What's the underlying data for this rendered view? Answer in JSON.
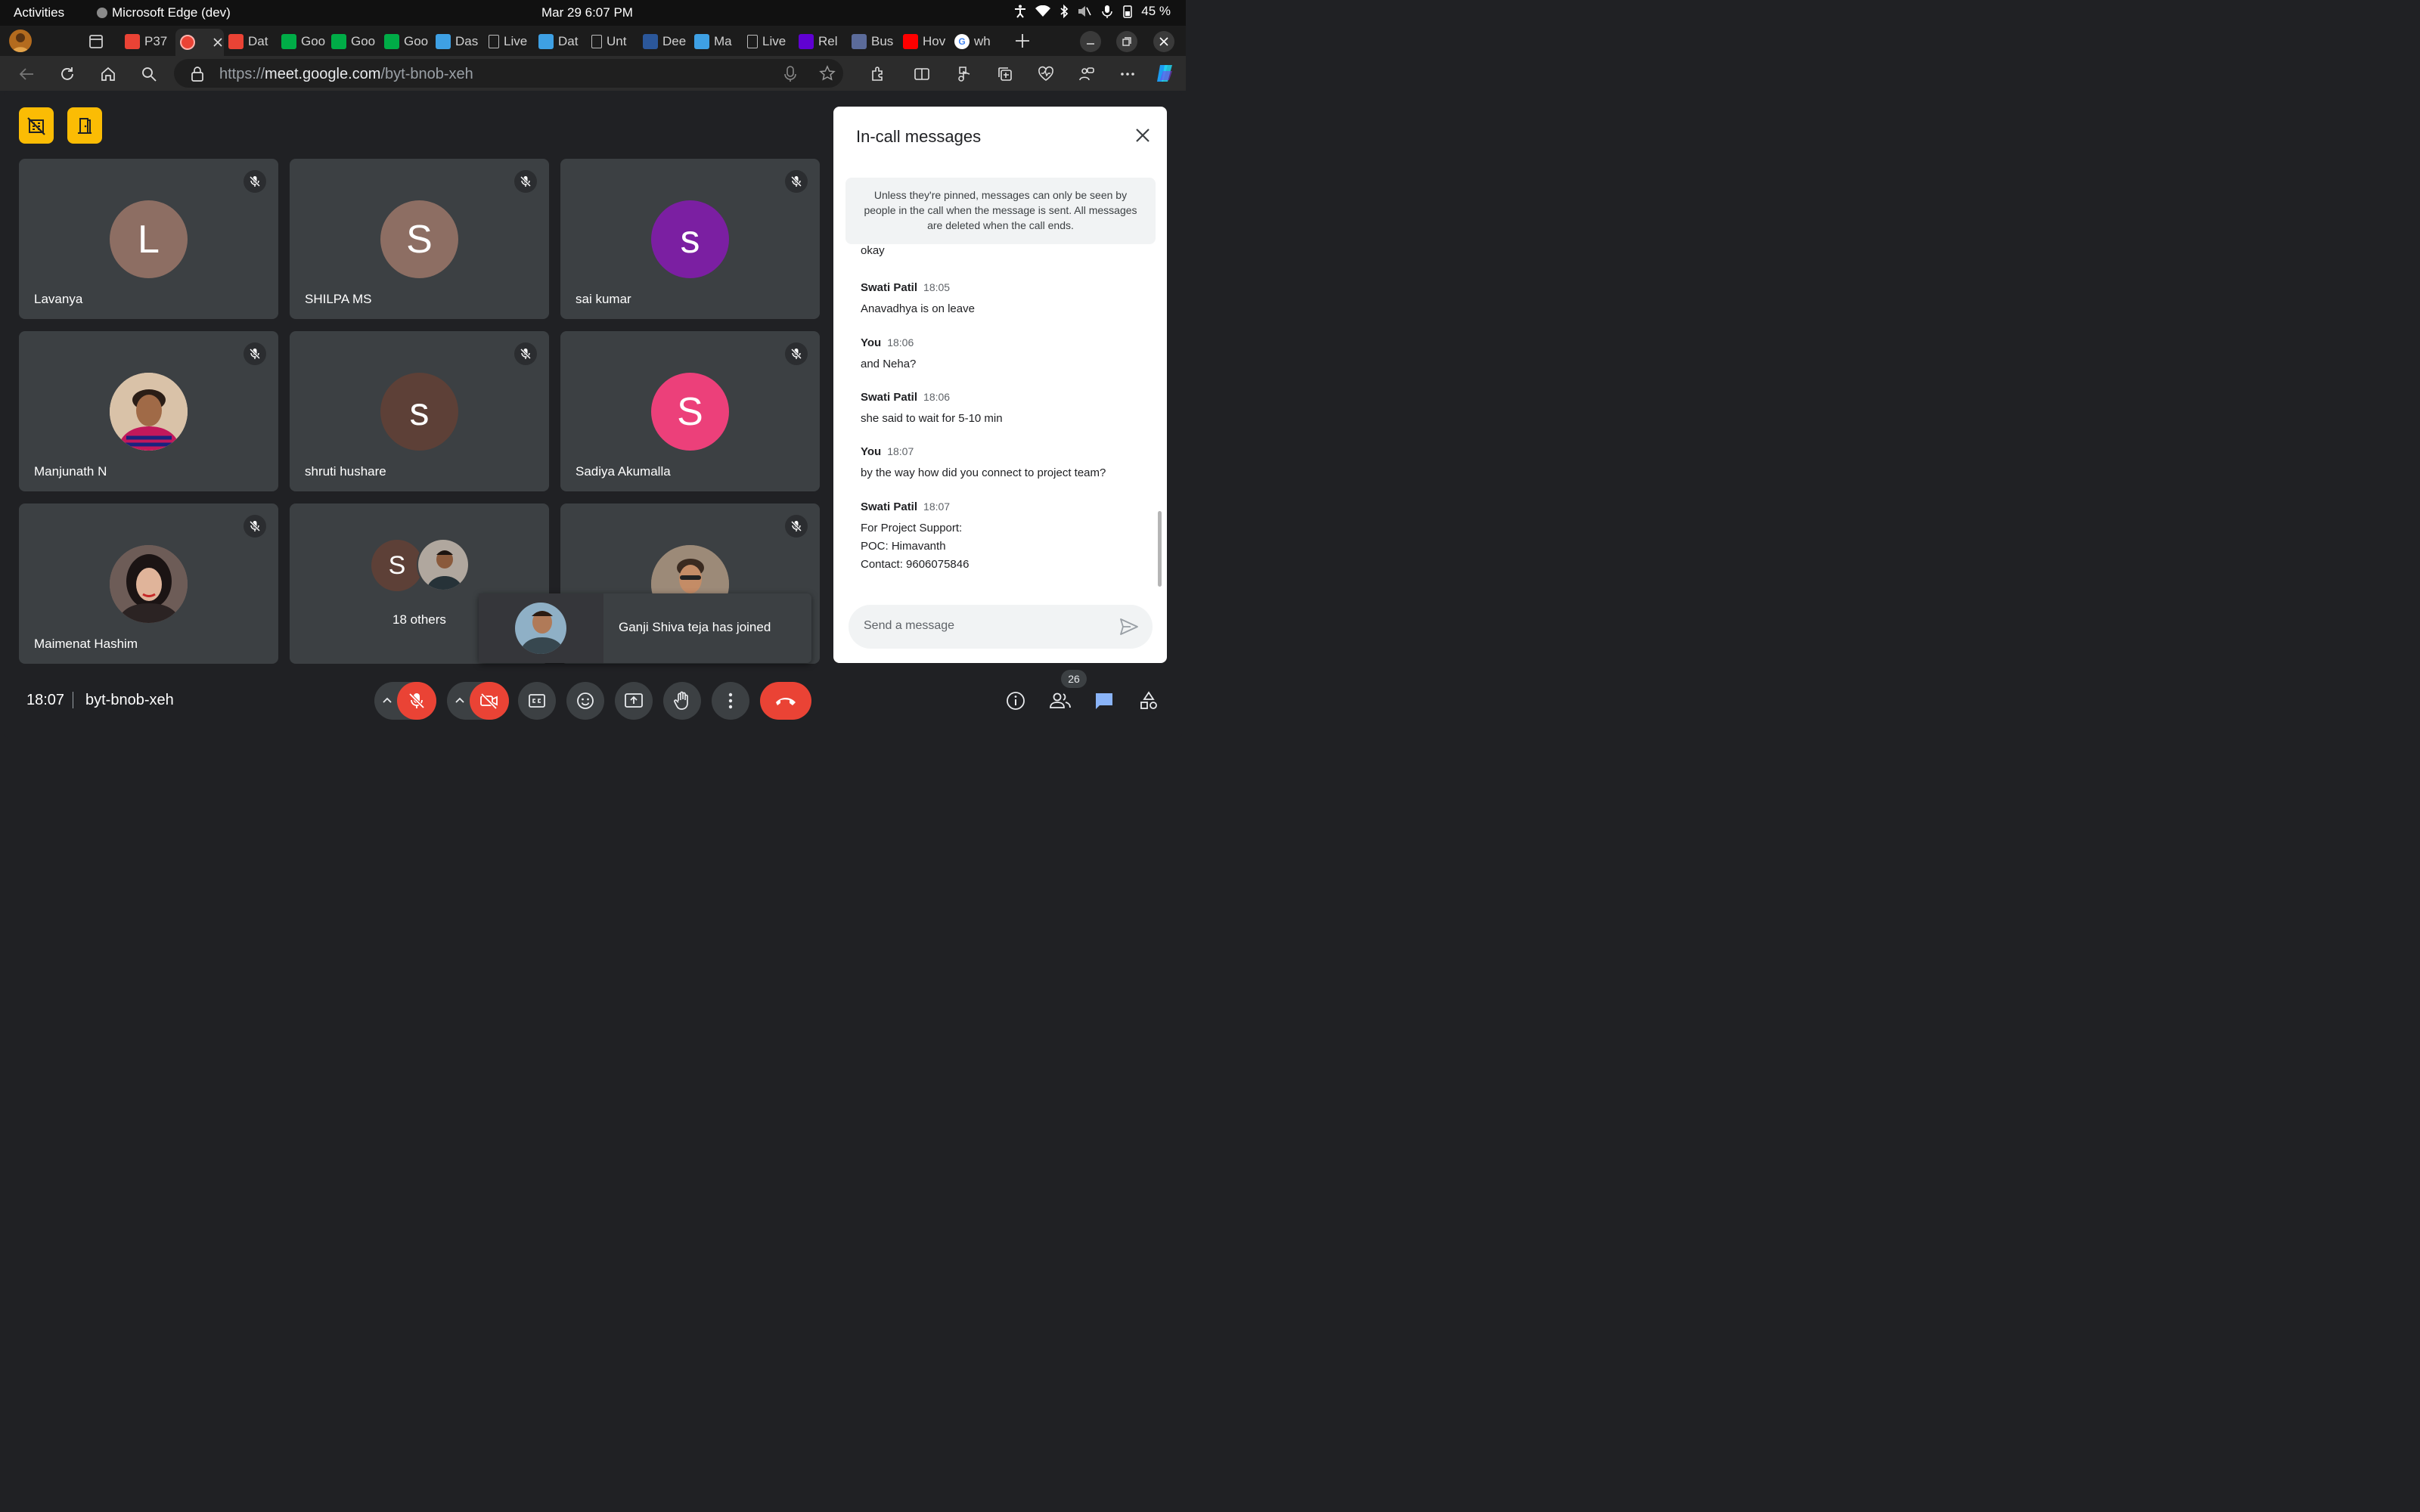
{
  "topbar": {
    "activities": "Activities",
    "app_name": "Microsoft Edge (dev)",
    "clock": "Mar 29   6:07 PM",
    "battery": "45 %"
  },
  "tabs": [
    {
      "label": "P37",
      "icon": "gmail-icon",
      "color": "#ea4335"
    },
    {
      "label": "",
      "icon": "recording-icon",
      "color": "#ea4335"
    },
    {
      "label": "Dat",
      "icon": "gmail-icon",
      "color": "#ea4335"
    },
    {
      "label": "Goo",
      "icon": "meet-icon",
      "color": "#00ac47"
    },
    {
      "label": "Goo",
      "icon": "meet-icon",
      "color": "#00ac47"
    },
    {
      "label": "Goo",
      "icon": "meet-icon",
      "color": "#00ac47"
    },
    {
      "label": "Das",
      "icon": "edge-icon",
      "color": "#3ea0e4"
    },
    {
      "label": "Live",
      "icon": "page-icon",
      "color": "#9aa0a6"
    },
    {
      "label": "Dat",
      "icon": "edge-icon",
      "color": "#3ea0e4"
    },
    {
      "label": "Unt",
      "icon": "page-icon",
      "color": "#9aa0a6"
    },
    {
      "label": "Dee",
      "icon": "word-icon",
      "color": "#2b579a"
    },
    {
      "label": "Ma",
      "icon": "edge-icon",
      "color": "#3ea0e4"
    },
    {
      "label": "Live",
      "icon": "page-icon",
      "color": "#9aa0a6"
    },
    {
      "label": "Rel",
      "icon": "yahoo-icon",
      "color": "#6001d2"
    },
    {
      "label": "Bus",
      "icon": "app-icon",
      "color": "#5b6b9a"
    },
    {
      "label": "Hov",
      "icon": "youtube-icon",
      "color": "#ff0000"
    },
    {
      "label": "wh",
      "icon": "google-icon",
      "color": "#ffffff"
    }
  ],
  "address": {
    "scheme": "https://",
    "host": "meet.google.com",
    "path": "/byt-bnob-xeh"
  },
  "participants": [
    {
      "name": "Lavanya",
      "initial": "L",
      "color": "#8d6e63",
      "photo": false
    },
    {
      "name": "SHILPA MS",
      "initial": "S",
      "color": "#8d6e63",
      "photo": false
    },
    {
      "name": "sai kumar",
      "initial": "s",
      "color": "#7b1fa2",
      "photo": false
    },
    {
      "name": "Manjunath N",
      "initial": "",
      "color": "#c8a88a",
      "photo": true
    },
    {
      "name": "shruti hushare",
      "initial": "s",
      "color": "#5d4037",
      "photo": false
    },
    {
      "name": "Sadiya Akumalla",
      "initial": "S",
      "color": "#ec407a",
      "photo": false
    },
    {
      "name": "Maimenat Hashim",
      "initial": "",
      "color": "#7a6a66",
      "photo": true
    }
  ],
  "others": {
    "label": "18 others",
    "initial": "S",
    "color": "#5d4037"
  },
  "toast": {
    "text": "Ganji Shiva teja has joined"
  },
  "chat": {
    "title": "In-call messages",
    "notice": "Unless they're pinned, messages can only be seen by people in the call when the message is sent. All messages are deleted when the call ends.",
    "cut_text": "okay",
    "messages": [
      {
        "sender": "Swati Patil",
        "time": "18:05",
        "lines": [
          "Anavadhya is on leave"
        ]
      },
      {
        "sender": "You",
        "time": "18:06",
        "lines": [
          "and Neha?"
        ]
      },
      {
        "sender": "Swati Patil",
        "time": "18:06",
        "lines": [
          "she said to wait for 5-10 min"
        ]
      },
      {
        "sender": "You",
        "time": "18:07",
        "lines": [
          "by the way how did you connect to project team?"
        ]
      },
      {
        "sender": "Swati Patil",
        "time": "18:07",
        "lines": [
          "For Project Support:",
          "POC: Himavanth",
          "Contact: 9606075846"
        ]
      }
    ],
    "input_placeholder": "Send a message"
  },
  "bottom": {
    "clock": "18:07",
    "meeting_code": "byt-bnob-xeh",
    "people_count": "26"
  },
  "colors": {
    "meet_bg": "#202124",
    "tile": "#3c4043",
    "danger": "#ea4335",
    "accent": "#fbbc04",
    "chat_blue": "#8ab4f8"
  }
}
